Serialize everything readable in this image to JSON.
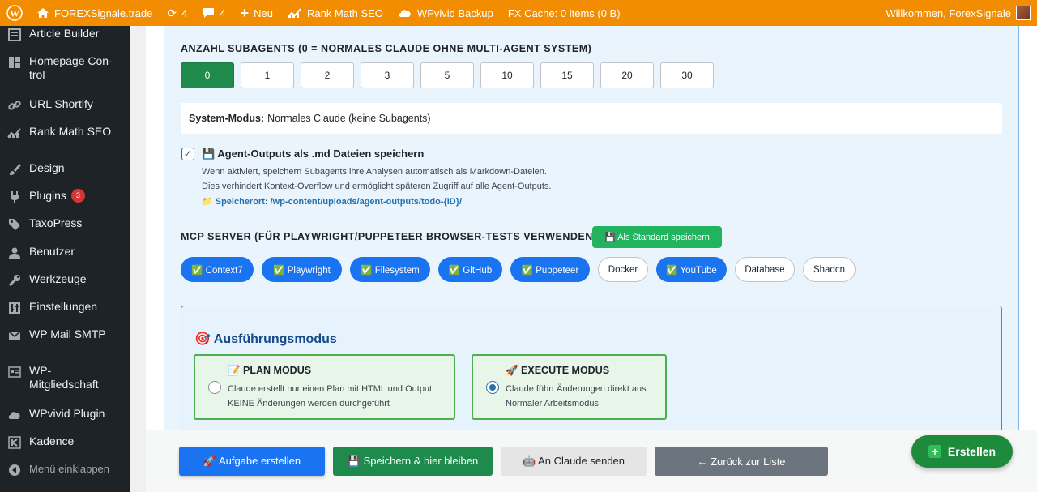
{
  "adminbar": {
    "site_name": "FOREXSignale.trade",
    "updates_count": "4",
    "comments_count": "4",
    "new_label": "Neu",
    "rankmath_label": "Rank Math SEO",
    "wpvivid_label": "WPvivid Backup",
    "fxcache_label": "FX Cache: 0 items (0 B)",
    "greeting": "Willkommen, ForexSignale"
  },
  "sidebar": {
    "items": [
      {
        "label": "Article Builder",
        "icon": "article-icon"
      },
      {
        "label": "Homepage Con-trol",
        "icon": "layout-icon"
      },
      {
        "label": "URL Shortify",
        "icon": "link-icon"
      },
      {
        "label": "Rank Math SEO",
        "icon": "chart-icon"
      },
      {
        "label": "Design",
        "icon": "brush-icon"
      },
      {
        "label": "Plugins",
        "icon": "plugin-icon",
        "badge": "3"
      },
      {
        "label": "TaxoPress",
        "icon": "tag-icon"
      },
      {
        "label": "Benutzer",
        "icon": "user-icon"
      },
      {
        "label": "Werkzeuge",
        "icon": "wrench-icon"
      },
      {
        "label": "Einstellungen",
        "icon": "settings-icon"
      },
      {
        "label": "WP Mail SMTP",
        "icon": "mail-icon"
      },
      {
        "label": "WP-Mitgliedschaft",
        "icon": "members-icon"
      },
      {
        "label": "WPvivid Plugin",
        "icon": "cloud-icon"
      },
      {
        "label": "Kadence",
        "icon": "kadence-icon"
      },
      {
        "label": "Menü einklappen",
        "icon": "collapse-icon"
      }
    ]
  },
  "subagents": {
    "title": "ANZAHL SUBAGENTS (0 = NORMALES CLAUDE OHNE MULTI-AGENT SYSTEM)",
    "options": [
      "0",
      "1",
      "2",
      "3",
      "5",
      "10",
      "15",
      "20",
      "30"
    ],
    "selected": "0"
  },
  "system_mode": {
    "label": "System-Modus:",
    "value": "Normales Claude (keine Subagents)"
  },
  "save_outputs": {
    "title": "💾 Agent-Outputs als .md Dateien speichern",
    "checked": true,
    "desc1": "Wenn aktiviert, speichern Subagents ihre Analysen automatisch als Markdown-Dateien.",
    "desc2": "Dies verhindert Kontext-Overflow und ermöglicht späteren Zugriff auf alle Agent-Outputs.",
    "path": "📁 Speicherort: /wp-content/uploads/agent-outputs/todo-{ID}/"
  },
  "mcp": {
    "title": "MCP SERVER (FÜR PLAYWRIGHT/PUPPETEER BROWSER-TESTS VERWENDEN)",
    "save_default_label": "💾 Als Standard speichern",
    "servers": [
      {
        "label": "✅ Context7",
        "active": true
      },
      {
        "label": "✅ Playwright",
        "active": true
      },
      {
        "label": "✅ Filesystem",
        "active": true
      },
      {
        "label": "✅ GitHub",
        "active": true
      },
      {
        "label": "✅ Puppeteer",
        "active": true
      },
      {
        "label": "Docker",
        "active": false
      },
      {
        "label": "✅ YouTube",
        "active": true
      },
      {
        "label": "Database",
        "active": false
      },
      {
        "label": "Shadcn",
        "active": false
      }
    ]
  },
  "execution": {
    "title": "🎯 Ausführungsmodus",
    "plan": {
      "title": "📝 PLAN MODUS",
      "line1": "Claude erstellt nur einen Plan mit HTML und Output",
      "line2": "KEINE Änderungen werden durchgeführt",
      "selected": false
    },
    "execute": {
      "title": "🚀 EXECUTE MODUS",
      "line1": "Claude führt Änderungen direkt aus",
      "line2": "Normaler Arbeitsmodus",
      "selected": true
    }
  },
  "footer": {
    "create_task": "🚀 Aufgabe erstellen",
    "save_stay": "💾 Speichern & hier bleiben",
    "send_claude": "🤖 An Claude senden",
    "back_list": "← Zurück zur Liste"
  },
  "fab": {
    "label": "Erstellen"
  },
  "colors": {
    "adminbar": "#f28c00",
    "sidebar": "#1d2327",
    "primary_green": "#1e8a4c",
    "primary_blue": "#1a73f0"
  }
}
